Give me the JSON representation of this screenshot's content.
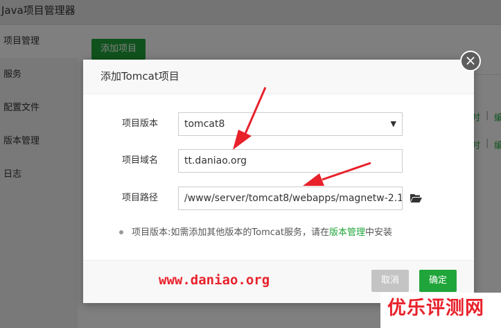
{
  "app": {
    "title": "Java项目管理器",
    "sidebar": [
      {
        "label": "项目管理",
        "active": true
      },
      {
        "label": "服务",
        "active": false
      },
      {
        "label": "配置文件",
        "active": false
      },
      {
        "label": "版本管理",
        "active": false
      },
      {
        "label": "日志",
        "active": false
      }
    ],
    "add_button": "添加项目",
    "row_links": [
      "时",
      "|",
      "编",
      "时",
      "|",
      "编"
    ]
  },
  "dialog": {
    "title": "添加Tomcat项目",
    "fields": {
      "version_label": "项目版本",
      "version_value": "tomcat8",
      "domain_label": "项目域名",
      "domain_value": "tt.daniao.org",
      "path_label": "项目路径",
      "path_value": "/www/server/tomcat8/webapps/magnetw-2.1"
    },
    "tip_prefix": "项目版本:如需添加其他版本的Tomcat服务，请在",
    "tip_link": "版本管理",
    "tip_suffix": "中安装",
    "cancel_label": "取消",
    "ok_label": "确定",
    "close_symbol": "×"
  },
  "watermarks": {
    "site": "www.daniao.org",
    "brand": "优乐评测网"
  },
  "colors": {
    "accent": "#20a53a",
    "annotation": "#e8212b",
    "overlay": "rgba(0,0,0,0.5)"
  },
  "icons": {
    "folder": "folder-open-icon",
    "caret": "caret-down-icon",
    "close": "close-icon"
  }
}
